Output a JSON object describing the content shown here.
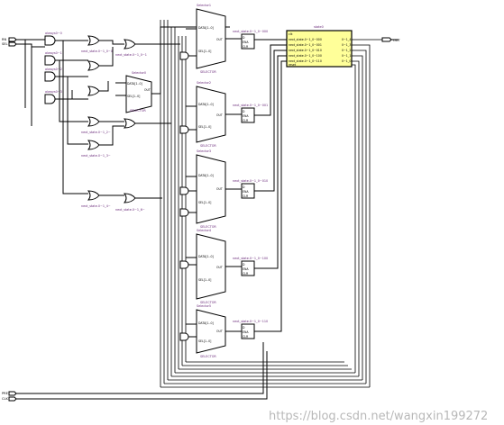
{
  "ports": {
    "inputs_top": [
      "RN",
      "SEL"
    ],
    "output": "OUT",
    "inputs_bottom": [
      "PRE",
      "CLK"
    ]
  },
  "gates": [
    {
      "label": "always0~0"
    },
    {
      "label": "always0~1"
    },
    {
      "label": "always0~2"
    },
    {
      "label": "always0~3"
    },
    {
      "label": "next_state.0~1_0~0"
    },
    {
      "label": "next_state.0~1_2~"
    },
    {
      "label": "next_state.0~1_3~"
    },
    {
      "label": "next_state.0~1_4~"
    },
    {
      "label": "next_state.0~1_0~1"
    },
    {
      "label": "next_state.0~1_6~"
    }
  ],
  "selectors": [
    {
      "name": "Selector0",
      "label": "SELECTOR",
      "out": "OUT",
      "data_pins": [
        "DATA[1..0]"
      ],
      "sel_pins": [
        "SEL[1..0]"
      ]
    },
    {
      "name": "Selector1",
      "label": "SELECTOR",
      "out": "OUT",
      "data_pins": [
        "DATA[1..0]"
      ],
      "sel_pins": [
        "SEL[1..0]"
      ]
    },
    {
      "name": "Selector2",
      "label": "SELECTOR",
      "out": "OUT",
      "data_pins": [
        "DATA[1..0]"
      ],
      "sel_pins": [
        "SEL[1..0]"
      ]
    },
    {
      "name": "Selector3",
      "label": "SELECTOR",
      "out": "OUT",
      "data_pins": [
        "DATA[1..0]"
      ],
      "sel_pins": [
        "SEL[1..0]"
      ]
    },
    {
      "name": "Selector4",
      "label": "SELECTOR",
      "out": "OUT",
      "data_pins": [
        "DATA[1..0]"
      ],
      "sel_pins": [
        "SEL[1..0]"
      ]
    },
    {
      "name": "Selector5",
      "label": "SELECTOR",
      "out": "OUT",
      "data_pins": [
        "DATA[1..0]"
      ],
      "sel_pins": [
        "SEL[1..0]"
      ]
    }
  ],
  "registers": [
    {
      "label": "next_state.0~1_0~000",
      "pins": [
        "D",
        "ENA",
        "CLR",
        "Q"
      ]
    },
    {
      "label": "next_state.0~1_0~001",
      "pins": [
        "D",
        "ENA",
        "CLR",
        "Q"
      ]
    },
    {
      "label": "next_state.0~1_0~010",
      "pins": [
        "D",
        "ENA",
        "CLR",
        "Q"
      ]
    },
    {
      "label": "next_state.0~1_0~100",
      "pins": [
        "D",
        "ENA",
        "CLR",
        "Q"
      ]
    },
    {
      "label": "next_state.0~1_0~110",
      "pins": [
        "D",
        "ENA",
        "CLR",
        "Q"
      ]
    }
  ],
  "state_block": {
    "name": "state0",
    "header": "clk",
    "rows": [
      {
        "left": "next_state.0~1_0~000",
        "right": "0~1_4"
      },
      {
        "left": "next_state.0~1_0~001",
        "right": "0~1_3"
      },
      {
        "left": "next_state.0~1_0~010",
        "right": "0~1_2"
      },
      {
        "left": "next_state.0~1_0~100",
        "right": "0~1_1"
      },
      {
        "left": "next_state.0~1_0~110",
        "right": "0~1_0"
      }
    ],
    "footer": "reset",
    "fill_color": "#ffff99"
  },
  "watermark": "https://blog.csdn.net/wangxin199272"
}
